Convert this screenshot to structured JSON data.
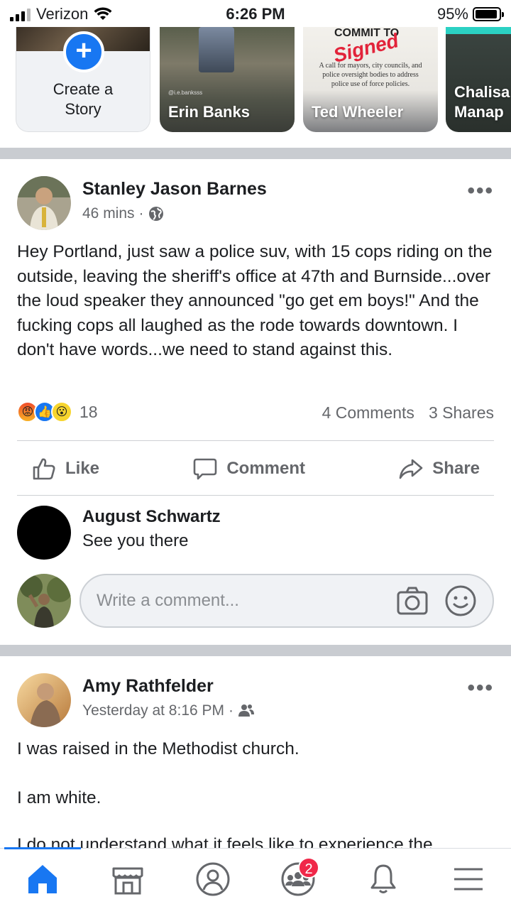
{
  "status_bar": {
    "carrier": "Verizon",
    "time": "6:26 PM",
    "battery_pct": "95%",
    "battery_level": 0.95
  },
  "stories": {
    "create_label": "Create a Story",
    "items": [
      {
        "name": "Erin Banks",
        "caption": "@i.e.banksss"
      },
      {
        "name": "Ted Wheeler",
        "headline": "COMMIT TO",
        "stamp": "Signed",
        "body": "A call for mayors, city councils, and police oversight bodies to address police use of force policies."
      },
      {
        "name": "Chalisa Manap"
      }
    ]
  },
  "post1": {
    "author": "Stanley Jason Barnes",
    "time": "46 mins",
    "audience_icon": "globe-icon",
    "text": "Hey Portland, just saw a police suv, with 15 cops riding on the outside, leaving the sheriff's office at 47th and Burnside...over the loud speaker they announced \"go get em boys!\" And the fucking cops all laughed as the rode towards downtown. I don't have words...we need to stand against this.",
    "reaction_count": "18",
    "comments": "4 Comments",
    "shares": "3 Shares",
    "actions": {
      "like": "Like",
      "comment": "Comment",
      "share": "Share"
    },
    "top_comment": {
      "author": "August Schwartz",
      "text": "See you there"
    },
    "compose_placeholder": "Write a comment..."
  },
  "post2": {
    "author": "Amy Rathfelder",
    "time": "Yesterday at 8:16 PM",
    "audience_icon": "friends-icon",
    "paragraph1": "I was raised in the Methodist church.",
    "paragraph2": "I am white.",
    "paragraph3": "I do not understand what it feels like to experience the"
  },
  "tabbar": {
    "groups_badge": "2"
  },
  "colors": {
    "accent": "#1877f2",
    "badge": "#f02849",
    "divider": "#c9ccd1",
    "secondary_text": "#65676b"
  }
}
